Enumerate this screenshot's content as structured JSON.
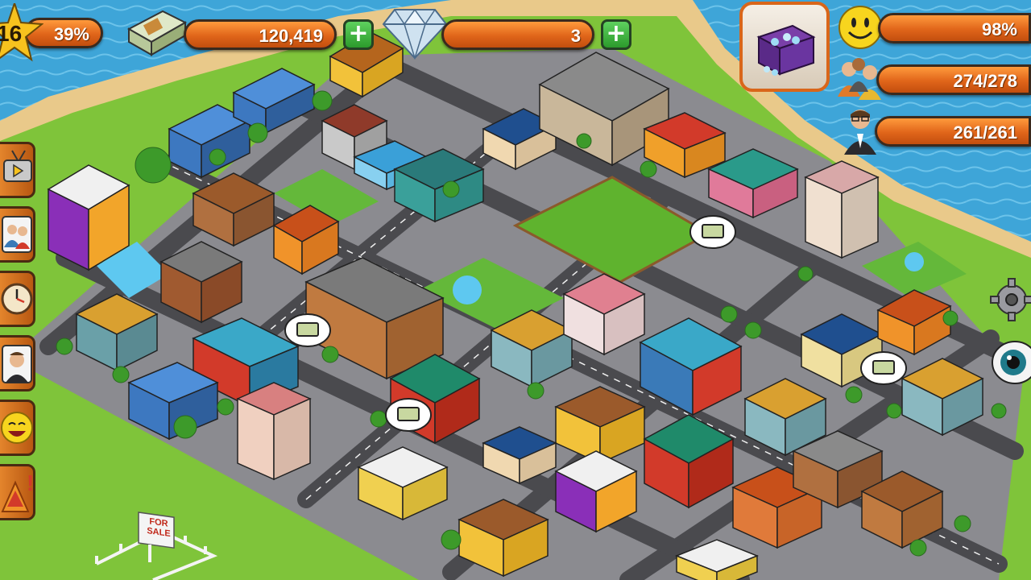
{
  "hud": {
    "level": {
      "value": "16",
      "progress": "39%"
    },
    "money": {
      "value": "120,419",
      "add_label": "+"
    },
    "diamonds": {
      "value": "3",
      "add_label": "+"
    },
    "happiness": {
      "value": "98%"
    },
    "population": {
      "value": "274/278"
    },
    "workers": {
      "value": "261/261"
    }
  },
  "sidebar": {
    "buttons": [
      {
        "icon": "tv-icon"
      },
      {
        "icon": "people-icon"
      },
      {
        "icon": "clock-icon"
      },
      {
        "icon": "advisor-icon"
      },
      {
        "icon": "smiley-icon"
      },
      {
        "icon": "alert-icon"
      }
    ]
  },
  "map": {
    "sign_text": [
      "FOR",
      "SALE"
    ]
  },
  "colors": {
    "bar_orange": "#e0651a",
    "plus_green": "#2c9a2c",
    "grass": "#7fc43a",
    "road": "#4a4a4e",
    "sand": "#e9c98a",
    "water": "#3fa7d6"
  }
}
